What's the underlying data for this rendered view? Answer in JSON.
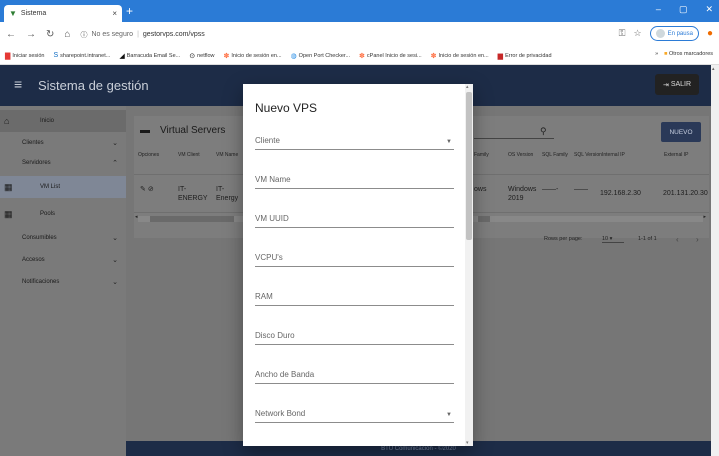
{
  "browser": {
    "tab_title": "Sistema",
    "tab_close": "×",
    "new_tab": "+",
    "win_min": "–",
    "win_max": "▢",
    "win_close": "✕",
    "security": "No es seguro",
    "url": "gestorvps.com/vpss",
    "pause_label": "En pausa",
    "bookmarks": [
      {
        "icon": "▇",
        "color": "#e53935",
        "label": "Iniciar sesión"
      },
      {
        "icon": "S",
        "color": "#0b6ac2",
        "label": "sharepoint.intranet..."
      },
      {
        "icon": "◢",
        "color": "#111111",
        "label": "Barracuda Email Se..."
      },
      {
        "icon": "⊙",
        "color": "#111111",
        "label": "netflow"
      },
      {
        "icon": "✽",
        "color": "#ff7043",
        "label": "Inicio de sesión en..."
      },
      {
        "icon": "◍",
        "color": "#1e88e5",
        "label": "Open Port Checker..."
      },
      {
        "icon": "✽",
        "color": "#ff7043",
        "label": "cPanel Inicio de sesi..."
      },
      {
        "icon": "✽",
        "color": "#ff7043",
        "label": "Inicio de sesión en..."
      },
      {
        "icon": "▆",
        "color": "#c62828",
        "label": "Error de privacidad"
      }
    ],
    "bookmarks_more": "»",
    "other_bookmarks": "Otros marcadores"
  },
  "app": {
    "title": "Sistema de gestión",
    "logout_label": "SALIR",
    "sidebar": [
      {
        "label": "Inicio",
        "icon": "home-icon",
        "glyph": "⌂",
        "chevron": ""
      },
      {
        "label": "Clientes",
        "icon": "",
        "glyph": "",
        "chevron": "⌄"
      },
      {
        "label": "Servidores",
        "icon": "",
        "glyph": "",
        "chevron": "⌃"
      },
      {
        "label": "VM List",
        "icon": "list-icon",
        "glyph": "▦",
        "chevron": ""
      },
      {
        "label": "Pools",
        "icon": "list-icon",
        "glyph": "▦",
        "chevron": ""
      },
      {
        "label": "Consumibles",
        "icon": "",
        "glyph": "",
        "chevron": "⌄"
      },
      {
        "label": "Accesos",
        "icon": "",
        "glyph": "",
        "chevron": "⌄"
      },
      {
        "label": "Notificaciones",
        "icon": "",
        "glyph": "",
        "chevron": "⌄"
      }
    ],
    "page_title": "Virtual Servers",
    "new_button": "NUEVO",
    "table": {
      "headers": [
        "Opciones",
        "VM Client",
        "VM Name",
        "Family",
        "OS Version",
        "SQL Family",
        "SQL Version",
        "Internal IP",
        "External IP"
      ],
      "rows": [
        {
          "client": "IT-ENERGY",
          "name": "IT-Energy",
          "family": "ows",
          "os_version": "Windows 2019",
          "sql_family": "——-",
          "sql_version": "——",
          "internal_ip": "192.168.2.30",
          "external_ip": "201.131.20.30"
        }
      ]
    },
    "pagination": {
      "rows_per_page_label": "Rows per page:",
      "rows_per_page": "10",
      "range": "1-1 of 1"
    },
    "footer": "BTU Comunicación - ©2020"
  },
  "dialog": {
    "title": "Nuevo VPS",
    "fields": [
      {
        "label": "Cliente",
        "type": "select"
      },
      {
        "label": "VM Name",
        "type": "text"
      },
      {
        "label": "VM UUID",
        "type": "text"
      },
      {
        "label": "VCPU's",
        "type": "text"
      },
      {
        "label": "RAM",
        "type": "text"
      },
      {
        "label": "Disco Duro",
        "type": "text"
      },
      {
        "label": "Ancho de Banda",
        "type": "text"
      },
      {
        "label": "Network Bond",
        "type": "select"
      }
    ]
  }
}
